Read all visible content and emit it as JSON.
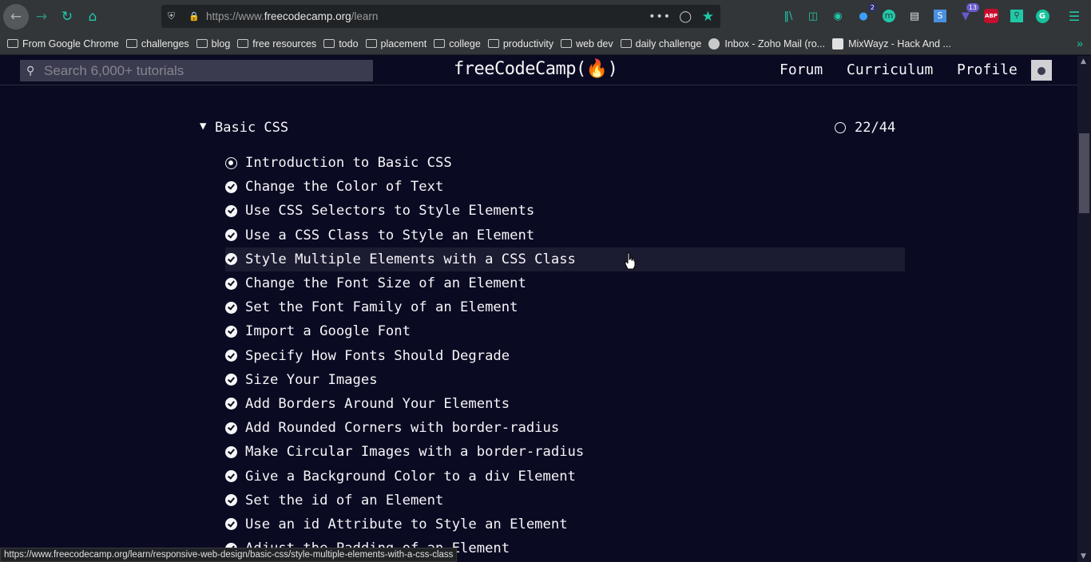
{
  "browser": {
    "url_prefix": "https://www.",
    "url_domain": "freecodecamp.org",
    "url_path": "/learn",
    "status_url": "https://www.freecodecamp.org/learn/responsive-web-design/basic-css/style-multiple-elements-with-a-css-class",
    "extension_badges": {
      "notifications": "2",
      "mail": "13"
    },
    "extension_icons": [
      "library-icon",
      "sidebar-icon",
      "account-icon",
      "notification-extension-icon",
      "m-extension-icon",
      "reader-icon",
      "s-extension-icon",
      "mail-extension-icon",
      "adblock-plus-icon",
      "search-extension-icon",
      "grammarly-icon",
      "menu-icon"
    ],
    "abp_label": "ABP",
    "bookmarks": [
      {
        "label": "From Google Chrome",
        "type": "folder"
      },
      {
        "label": "challenges",
        "type": "folder"
      },
      {
        "label": "blog",
        "type": "folder"
      },
      {
        "label": "free resources",
        "type": "folder"
      },
      {
        "label": "todo",
        "type": "folder"
      },
      {
        "label": "placement",
        "type": "folder"
      },
      {
        "label": "college",
        "type": "folder"
      },
      {
        "label": "productivity",
        "type": "folder"
      },
      {
        "label": "web dev",
        "type": "folder"
      },
      {
        "label": "daily challenge",
        "type": "folder"
      },
      {
        "label": "Inbox - Zoho Mail (ro...",
        "type": "site"
      },
      {
        "label": "MixWayz - Hack And ...",
        "type": "site"
      }
    ]
  },
  "nav": {
    "search_placeholder": "Search 6,000+ tutorials",
    "logo": "freeCodeCamp(🔥)",
    "forum": "Forum",
    "curriculum": "Curriculum",
    "profile": "Profile"
  },
  "block": {
    "title": "Basic CSS",
    "progress": "22/44"
  },
  "challenges": [
    {
      "title": "Introduction to Basic CSS",
      "status": "current"
    },
    {
      "title": "Change the Color of Text",
      "status": "done"
    },
    {
      "title": "Use CSS Selectors to Style Elements",
      "status": "done"
    },
    {
      "title": "Use a CSS Class to Style an Element",
      "status": "done"
    },
    {
      "title": "Style Multiple Elements with a CSS Class",
      "status": "done",
      "hover": true
    },
    {
      "title": "Change the Font Size of an Element",
      "status": "done"
    },
    {
      "title": "Set the Font Family of an Element",
      "status": "done"
    },
    {
      "title": "Import a Google Font",
      "status": "done"
    },
    {
      "title": "Specify How Fonts Should Degrade",
      "status": "done"
    },
    {
      "title": "Size Your Images",
      "status": "done"
    },
    {
      "title": "Add Borders Around Your Elements",
      "status": "done"
    },
    {
      "title": "Add Rounded Corners with border-radius",
      "status": "done"
    },
    {
      "title": "Make Circular Images with a border-radius",
      "status": "done"
    },
    {
      "title": "Give a Background Color to a div Element",
      "status": "done"
    },
    {
      "title": "Set the id of an Element",
      "status": "done"
    },
    {
      "title": "Use an id Attribute to Style an Element",
      "status": "done"
    },
    {
      "title": "Adjust the Padding of an Element",
      "status": "done"
    }
  ],
  "colors": {
    "page_bg": "#0a0a23",
    "text": "#f5f6f7",
    "accent": "#1fc9a8",
    "hover_row": "#1b1b32"
  }
}
